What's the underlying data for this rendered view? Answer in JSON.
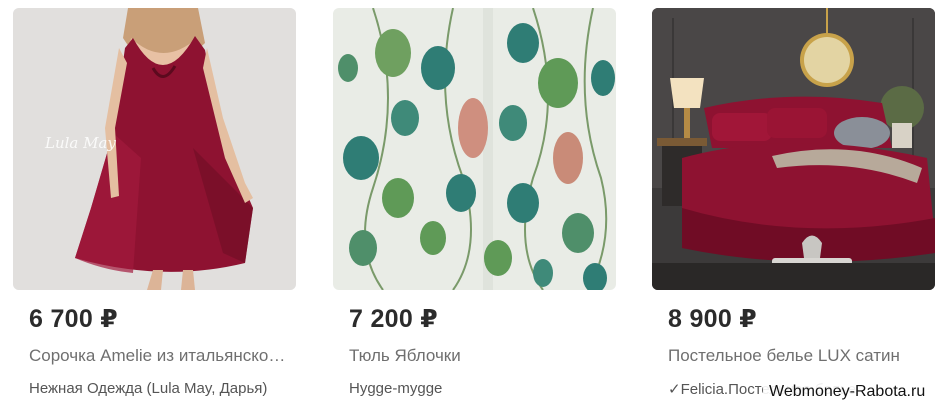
{
  "products": [
    {
      "price": "6 700 ₽",
      "title": "Сорочка Amelie из итальянского льна",
      "shop": "Нежная Одежда (Lula May, Дарья)",
      "image_watermark": "Lula May",
      "image_icon": "dress-photo"
    },
    {
      "price": "7 200 ₽",
      "title": "Тюль Яблочки",
      "shop": "Hygge-mygge",
      "image_icon": "eucalyptus-fabric-photo"
    },
    {
      "price": "8 900 ₽",
      "title": "Постельное белье LUX сатин",
      "shop": "✓Felicia.Постельное белье",
      "image_icon": "bedroom-photo"
    }
  ],
  "watermark": "Webmoney-Rabota.ru",
  "colors": {
    "price": "#2b2b2b",
    "title": "#6f6f6f",
    "shop": "#555555",
    "burgundy": "#8e1231",
    "leaf_teal": "#2f7d75",
    "leaf_green": "#5f9a57"
  }
}
